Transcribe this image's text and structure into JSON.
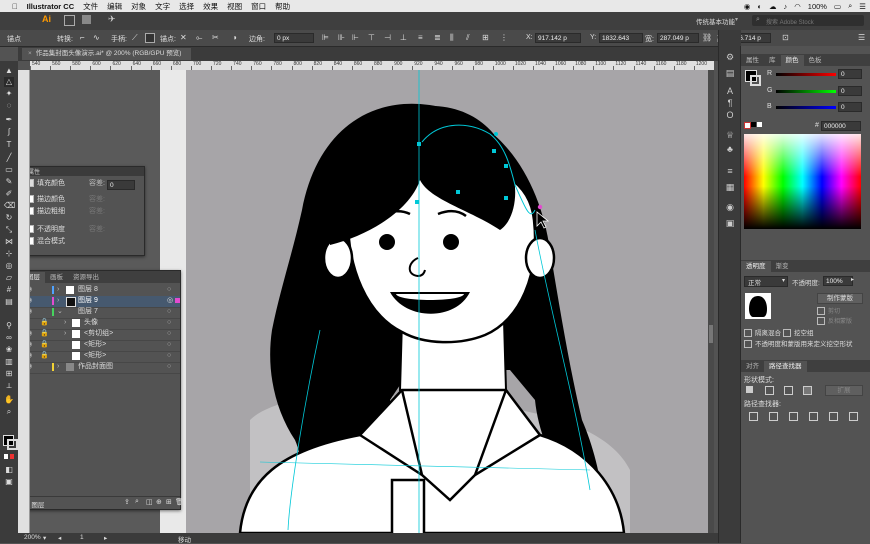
{
  "menubar": {
    "app_name": "Illustrator CC",
    "items": [
      "文件",
      "编辑",
      "对象",
      "文字",
      "选择",
      "效果",
      "视图",
      "窗口",
      "帮助"
    ],
    "status_percent": "100%"
  },
  "appbar": {
    "logo": "Ai",
    "workspace": "传统基本功能",
    "search_placeholder": "搜索 Adobe Stock"
  },
  "controlbar": {
    "mode": "锚点",
    "convert_label": "转换:",
    "handle_label": "手柄:",
    "anchor_label": "锚点:",
    "corner_label": "边角:",
    "corner_value": "0 px",
    "x_label": "X:",
    "x_value": "917.142 p",
    "y_label": "Y:",
    "y_value": "1832.643",
    "w_label": "宽:",
    "w_value": "287.049 p",
    "h_label": "高:",
    "h_value": "356.714 p"
  },
  "document": {
    "tab_title": "作品集封面头像演示.ai* @ 200% (RGB/GPU 预览)"
  },
  "ruler_marks": [
    "540",
    "560",
    "580",
    "600",
    "620",
    "640",
    "660",
    "680",
    "700",
    "720",
    "740",
    "760",
    "780",
    "800",
    "820",
    "840",
    "860",
    "880",
    "900",
    "920",
    "940",
    "960",
    "980",
    "1000",
    "1020",
    "1040",
    "1060",
    "1080",
    "1100",
    "1120",
    "1140",
    "1160",
    "1180",
    "1200"
  ],
  "appearance_panel": {
    "title": "属性",
    "fill_label": "填充颜色",
    "tolerance_label": "容差:",
    "tolerance_value": "0",
    "stroke_color_label": "描边颜色",
    "stroke_weight_label": "描边粗细",
    "opacity_label": "不透明度",
    "blend_label": "混合模式",
    "disabled_label": "容差:"
  },
  "layers_panel": {
    "tabs": [
      "图层",
      "画板",
      "资源导出"
    ],
    "rows": [
      {
        "name": "图层 8",
        "selected": false
      },
      {
        "name": "图层 9",
        "selected": true
      },
      {
        "name": "图层 7",
        "selected": false
      },
      {
        "name": "头像",
        "selected": false
      },
      {
        "name": "<剪切组>",
        "selected": false
      },
      {
        "name": "<矩形>",
        "selected": false
      },
      {
        "name": "<矩形>",
        "selected": false
      },
      {
        "name": "作品封面图",
        "selected": false
      }
    ],
    "count_label": "4 图层"
  },
  "color_panel": {
    "tabs": [
      "属性",
      "库",
      "颜色",
      "色板"
    ],
    "r_label": "R",
    "g_label": "G",
    "b_label": "B",
    "r_value": "0",
    "g_value": "0",
    "b_value": "0",
    "hex_label": "#",
    "hex_value": "000000"
  },
  "transparency_panel": {
    "tabs": [
      "透明度",
      "渐变"
    ],
    "mode": "正常",
    "opacity_label": "不透明度:",
    "opacity_value": "100%",
    "make_mask": "制作蒙版",
    "clip": "剪切",
    "invert": "反相蒙版",
    "isolate": "隔离混合",
    "knockout": "挖空组",
    "opacity_mask": "不透明度和蒙版用来定义挖空形状"
  },
  "pathfinder_panel": {
    "tabs": [
      "对齐",
      "路径查找器"
    ],
    "shape_modes": "形状模式:",
    "expand": "扩展",
    "pathfinders": "路径查找器:"
  },
  "statusbar": {
    "zoom": "200%",
    "page": "1",
    "tool": "移动"
  },
  "colors": {
    "accent": "#00c8d7",
    "anchor_selected": "#e34bd0",
    "hair": "#000000",
    "skin": "#ffffff",
    "bg_photo": "#a7a5a8",
    "layer_select": "#46596f"
  }
}
